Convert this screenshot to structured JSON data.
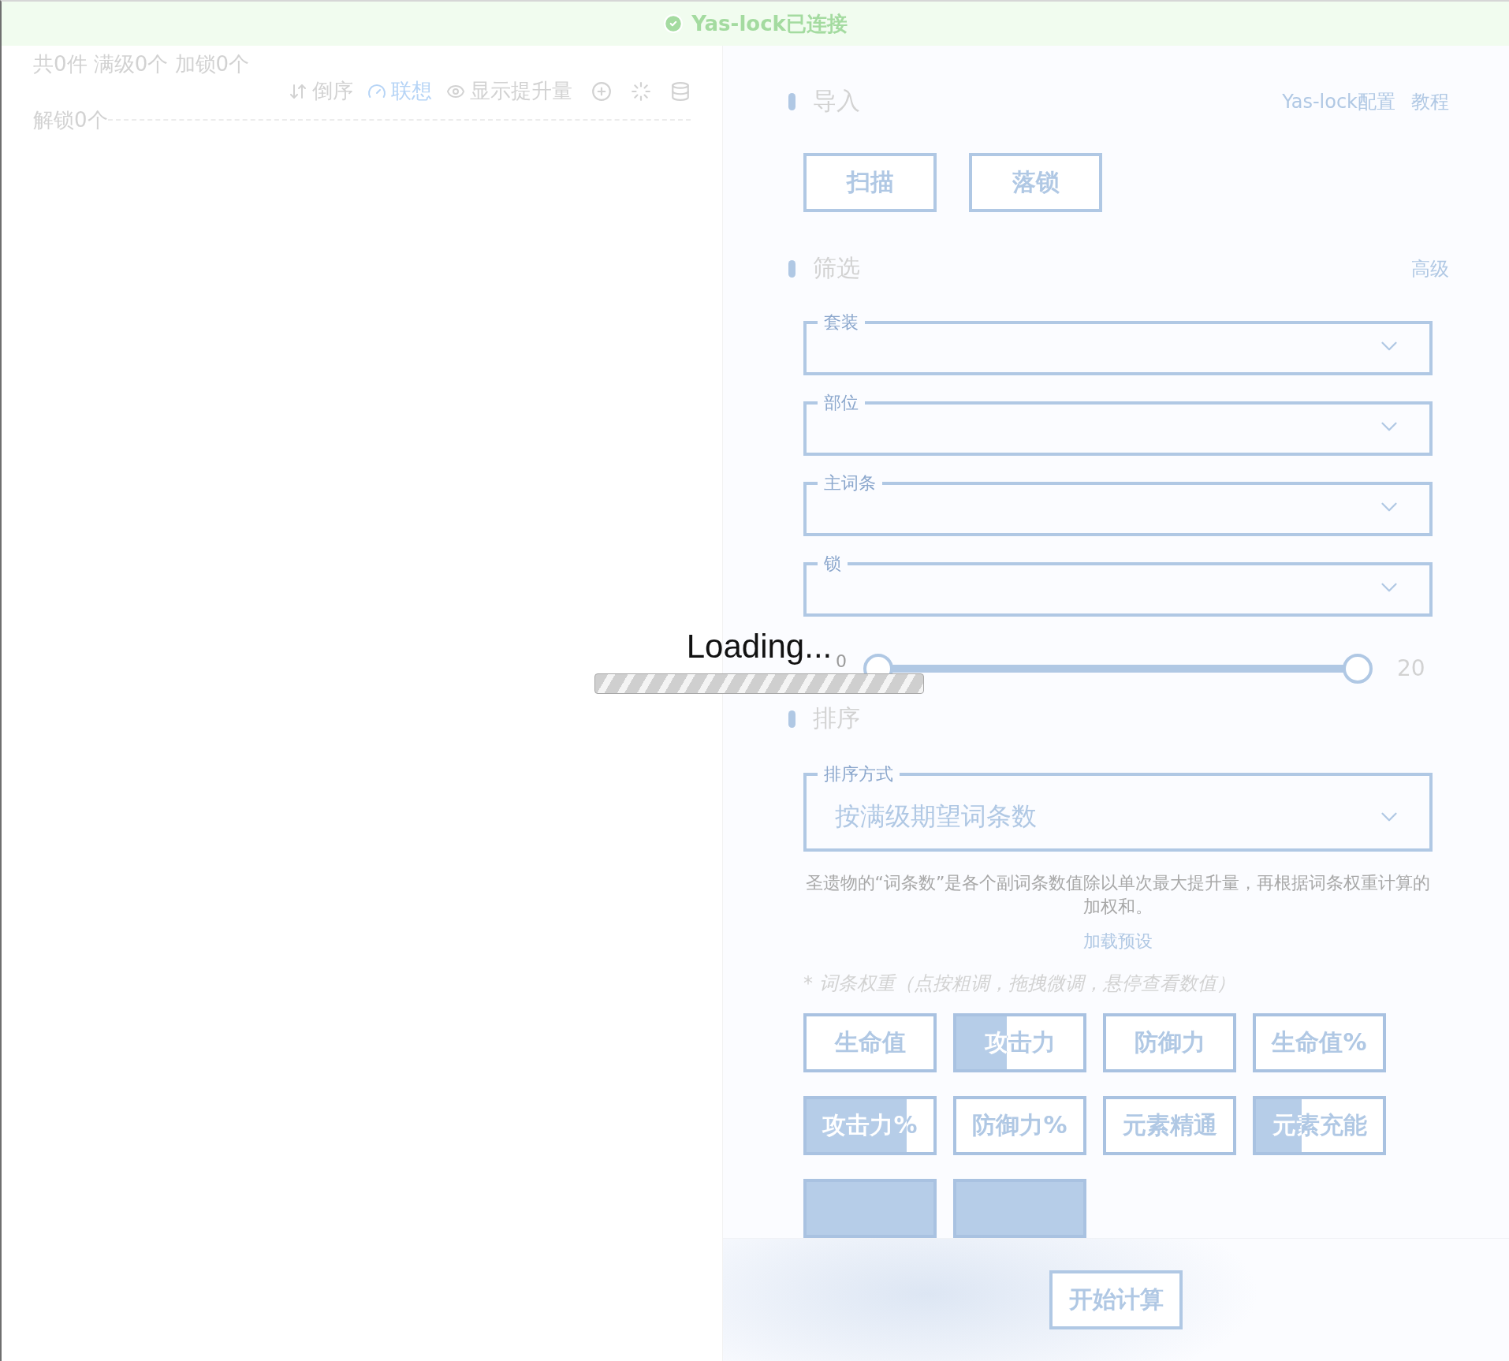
{
  "banner": {
    "text": "Yas-lock已连接",
    "connected": true
  },
  "summary": {
    "stats": "共0件 满级0个 加锁0个",
    "unlocked": "解锁0个"
  },
  "toolbar": [
    {
      "kind": "reverse",
      "label": "倒序",
      "on": false
    },
    {
      "kind": "associate",
      "label": "联想",
      "on": true
    },
    {
      "kind": "gain",
      "label": "显示提升量",
      "on": false
    },
    {
      "kind": "add"
    },
    {
      "kind": "magic"
    },
    {
      "kind": "storage"
    }
  ],
  "import": {
    "title": "导入",
    "links": [
      "Yas-lock配置",
      "教程"
    ],
    "buttons": [
      "扫描",
      "落锁"
    ]
  },
  "filter": {
    "title": "筛选",
    "link": "高级",
    "selects": [
      {
        "label": "套装"
      },
      {
        "label": "部位"
      },
      {
        "label": "主词条"
      },
      {
        "label": "锁"
      }
    ],
    "range": {
      "min_label": "0",
      "max_label": "20",
      "low": {
        "level": 0
      },
      "high": {
        "level": 1
      }
    }
  },
  "sort": {
    "title": "排序",
    "select": {
      "label": "排序方式",
      "value": "按满级期望词条数"
    },
    "description": "圣遗物的“词条数”是各个副词条数值除以单次最大提升量，再根据词条权重计算的加权和。",
    "preset_link": "加载预设",
    "weights_hint": "* 词条权重（点按粗调，拖拽微调，悬停查看数值）",
    "weights": [
      {
        "label": "生命值"
      },
      {
        "label": "攻击力",
        "level": 0.4
      },
      {
        "label": "防御力"
      },
      {
        "label": "生命值%"
      },
      {
        "label": "攻击力%",
        "level": 0.79
      },
      {
        "label": "防御力%"
      },
      {
        "label": "元素精通"
      },
      {
        "label": "元素充能",
        "level": 0.36
      },
      {
        "level": 1
      },
      {
        "level": 1
      }
    ]
  },
  "footer": {
    "button": "开始计算"
  },
  "loading": {
    "text": "Loading..."
  }
}
